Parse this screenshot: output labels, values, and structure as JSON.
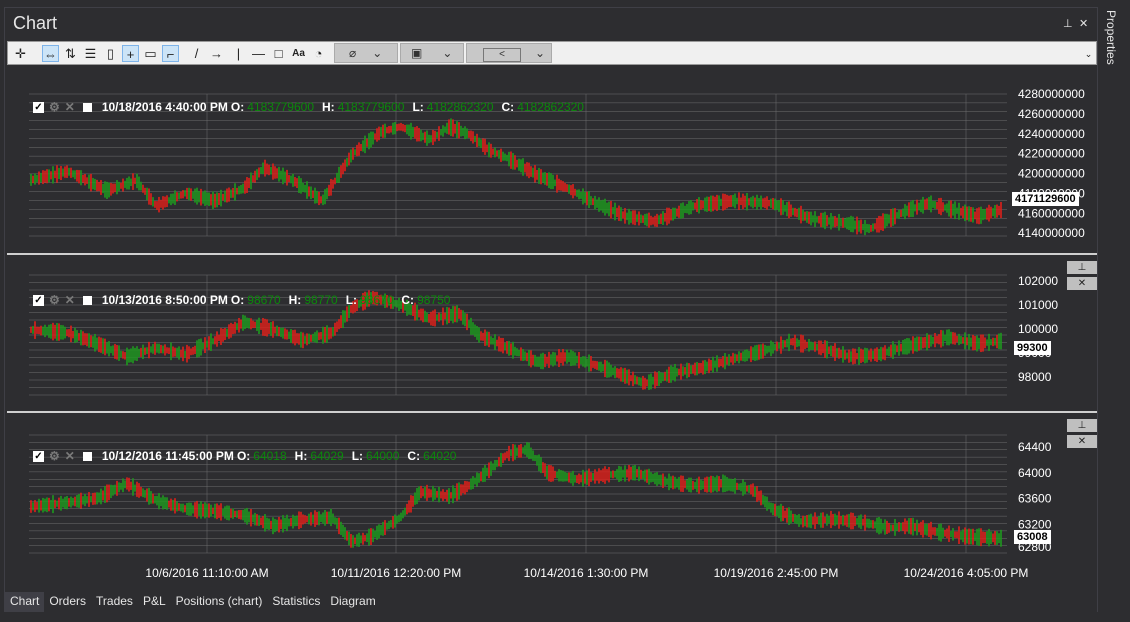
{
  "window": {
    "title": "Chart",
    "pin_icon": "pin-icon",
    "close_icon": "close-icon"
  },
  "side_panel": {
    "label": "Properties"
  },
  "toolbar": {
    "tools": [
      "cursor-cross-icon",
      "scroll-icon",
      "swap-icon",
      "list-icon",
      "page-icon",
      "crosshair-icon",
      "comment-icon",
      "step-icon",
      "line-icon",
      "arrow-icon",
      "vertical-line-icon",
      "horizontal-line-icon",
      "rectangle-icon",
      "text-icon",
      "gauge-icon"
    ],
    "dropdowns": [
      "brush-icon",
      "save-icon",
      "share-icon"
    ]
  },
  "panes": [
    {
      "legend": {
        "date": "10/18/2016 4:40:00 PM",
        "o_label": "O:",
        "o": "4183779600",
        "h_label": "H:",
        "h": "4183779600",
        "l_label": "L:",
        "l": "4182862320",
        "c_label": "C:",
        "c": "4182862320"
      },
      "last_value": "4171129600",
      "y_ticks": [
        "4280000000",
        "4260000000",
        "4240000000",
        "4220000000",
        "4200000000",
        "4180000000",
        "4160000000",
        "4140000000"
      ]
    },
    {
      "legend": {
        "date": "10/13/2016 8:50:00 PM",
        "o_label": "O:",
        "o": "98670",
        "h_label": "H:",
        "h": "98770",
        "l_label": "L:",
        "l": "98670",
        "c_label": "C:",
        "c": "98750"
      },
      "last_value": "99300",
      "y_ticks": [
        "102000",
        "101000",
        "100000",
        "99000",
        "98000"
      ]
    },
    {
      "legend": {
        "date": "10/12/2016 11:45:00 PM",
        "o_label": "O:",
        "o": "64018",
        "h_label": "H:",
        "h": "64029",
        "l_label": "L:",
        "l": "64000",
        "c_label": "C:",
        "c": "64020"
      },
      "last_value": "63008",
      "y_ticks": [
        "64400",
        "64000",
        "63600",
        "63200",
        "62800"
      ]
    }
  ],
  "x_ticks": [
    "10/6/2016 11:10:00 AM",
    "10/11/2016 12:20:00 PM",
    "10/14/2016 1:30:00 PM",
    "10/19/2016 2:45:00 PM",
    "10/24/2016 4:05:00 PM"
  ],
  "tabs": [
    "Chart",
    "Orders",
    "Trades",
    "P&L",
    "Positions (chart)",
    "Statistics",
    "Diagram"
  ],
  "colors": {
    "up": "#1e9a1e",
    "down": "#e0201a",
    "background": "#2d2d30",
    "grid": "#6e6e6e"
  }
}
